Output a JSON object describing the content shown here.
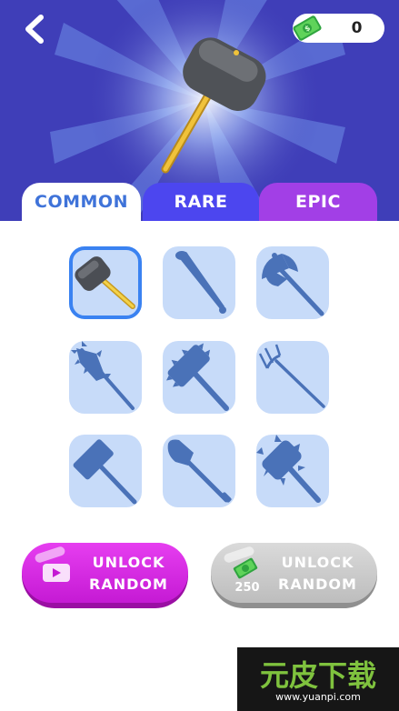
{
  "header": {
    "background_color": "#3f3eb8",
    "back_icon": "chevron-left-icon",
    "currency": {
      "icon": "cash-icon",
      "value": "0"
    },
    "preview_item": "sledgehammer"
  },
  "tabs": [
    {
      "label": "COMMON",
      "active": true,
      "color": "#ffffff"
    },
    {
      "label": "RARE",
      "active": false,
      "color": "#4c46ef"
    },
    {
      "label": "EPIC",
      "active": false,
      "color": "#a23fe6"
    }
  ],
  "grid": {
    "tile_color": "#c7dbf9",
    "silhouette_color": "#4a72b8",
    "items": [
      {
        "id": "sledgehammer",
        "selected": true,
        "unlocked": true
      },
      {
        "id": "baseball-bat",
        "selected": false,
        "unlocked": false
      },
      {
        "id": "battle-axe",
        "selected": false,
        "unlocked": false
      },
      {
        "id": "spiked-club",
        "selected": false,
        "unlocked": false
      },
      {
        "id": "spiked-hammer",
        "selected": false,
        "unlocked": false
      },
      {
        "id": "pitchfork",
        "selected": false,
        "unlocked": false
      },
      {
        "id": "mallet",
        "selected": false,
        "unlocked": false
      },
      {
        "id": "shovel",
        "selected": false,
        "unlocked": false
      },
      {
        "id": "spiked-mace",
        "selected": false,
        "unlocked": false
      }
    ]
  },
  "buttons": {
    "unlock_video": {
      "line1": "UNLOCK",
      "line2": "RANDOM",
      "icon": "video-play-icon",
      "color": "#d42ce0"
    },
    "unlock_cash": {
      "line1": "UNLOCK",
      "line2": "RANDOM",
      "icon": "cash-icon",
      "price": "250",
      "color": "#c8c8c8"
    }
  },
  "watermark": {
    "logo": "元皮下载",
    "url": "www.yuanpi.com"
  }
}
